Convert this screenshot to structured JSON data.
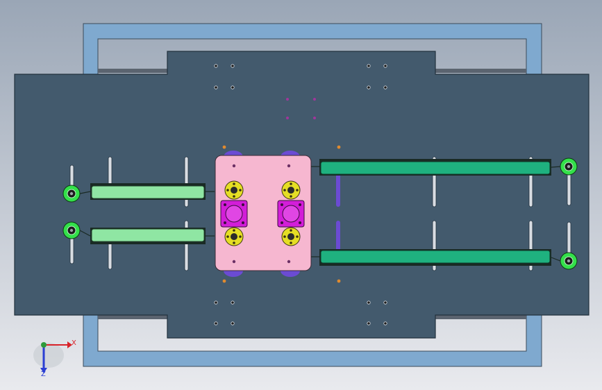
{
  "viewport": {
    "background_top": "#9aa6b6",
    "background_bottom": "#e9eaee"
  },
  "colors": {
    "frame_blue": "#7fa9cf",
    "frame_border": "#3b4a5a",
    "plate": "#435a6d",
    "plate_edge": "#22313d",
    "slot": "#d9dde3",
    "carriage": "#f6b7d0",
    "clamp_purple": "#6b4bd3",
    "yellow_fitting": "#e5de24",
    "magenta_fitting": "#d21ed8",
    "rail_light_green": "#8fe6a3",
    "rail_dark_green": "#1fb17f",
    "roller_green": "#33e04a",
    "hole_dark": "#1b1b1b",
    "hole_orange": "#e08a2e",
    "hole_magenta": "#a0369b",
    "axis_x": "#d8232a",
    "axis_y": "#2e9a3a",
    "axis_z": "#2b3fd3"
  },
  "triad": {
    "x_label": "X",
    "z_label": "Z"
  }
}
